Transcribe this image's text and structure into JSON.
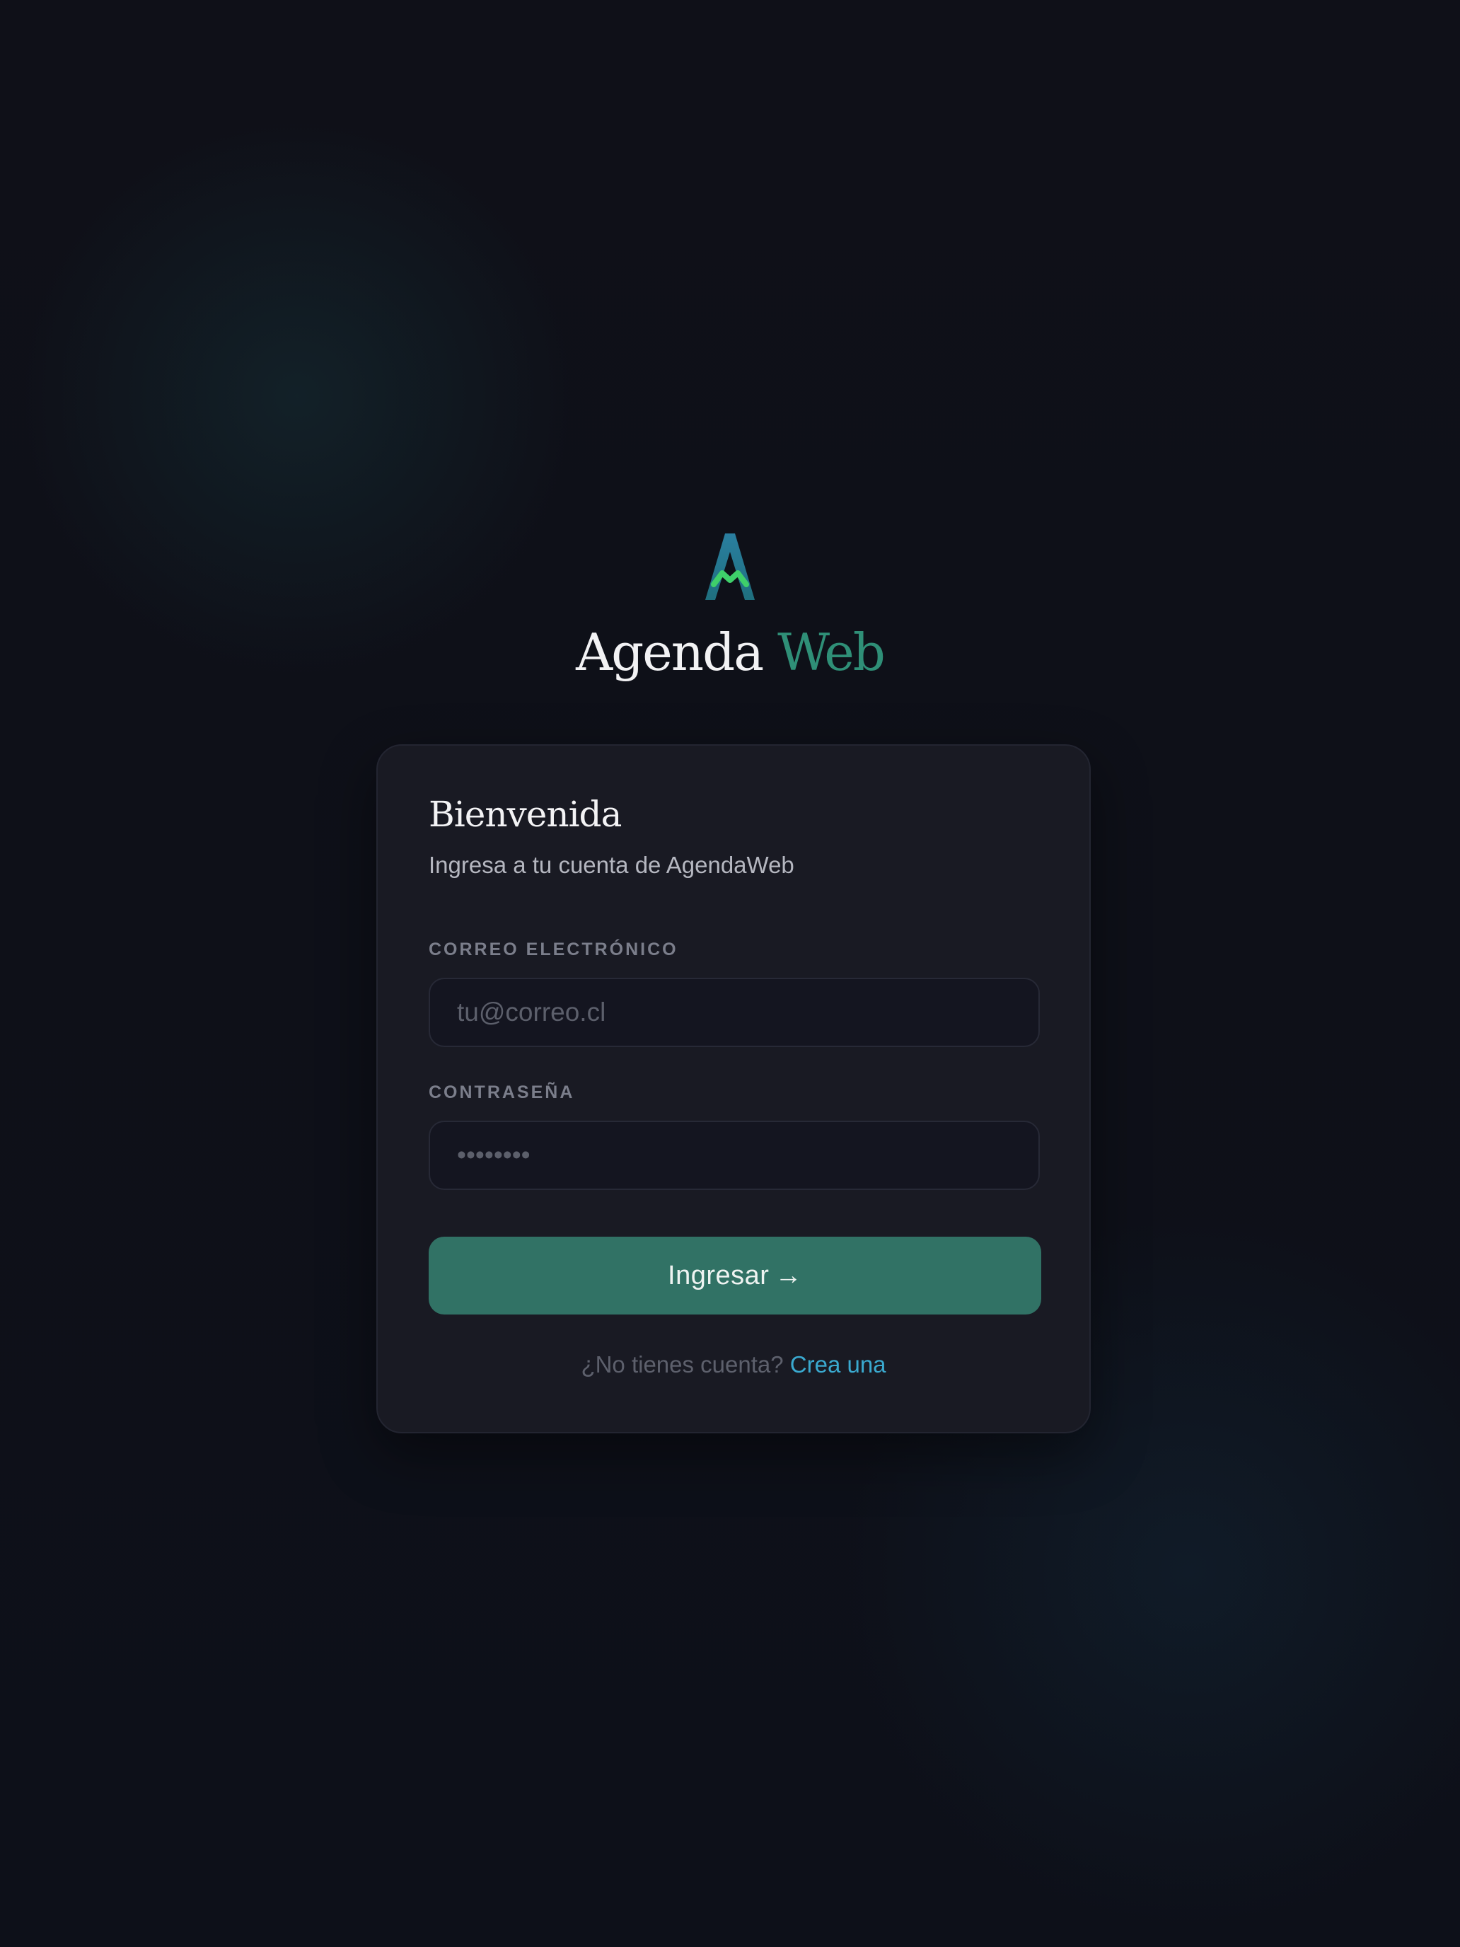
{
  "app": {
    "name_main": "Agenda",
    "name_accent": "Web"
  },
  "colors": {
    "accent": "#2f8f77",
    "button": "#317265",
    "link": "#3aa9cf",
    "background": "#0e1017",
    "card": "#191a23"
  },
  "icons": {
    "logo": "letter-a-logo-icon",
    "submit_arrow": "arrow-right-icon"
  },
  "login": {
    "title": "Bienvenida",
    "subtitle": "Ingresa a tu cuenta de AgendaWeb",
    "email": {
      "label": "CORREO ELECTRÓNICO",
      "placeholder": "tu@correo.cl",
      "value": ""
    },
    "password": {
      "label": "CONTRASEÑA",
      "placeholder": "••••••••",
      "value": ""
    },
    "submit_label": "Ingresar",
    "submit_arrow": "→",
    "signup_prompt": "¿No tienes cuenta?",
    "signup_link": "Crea una"
  }
}
